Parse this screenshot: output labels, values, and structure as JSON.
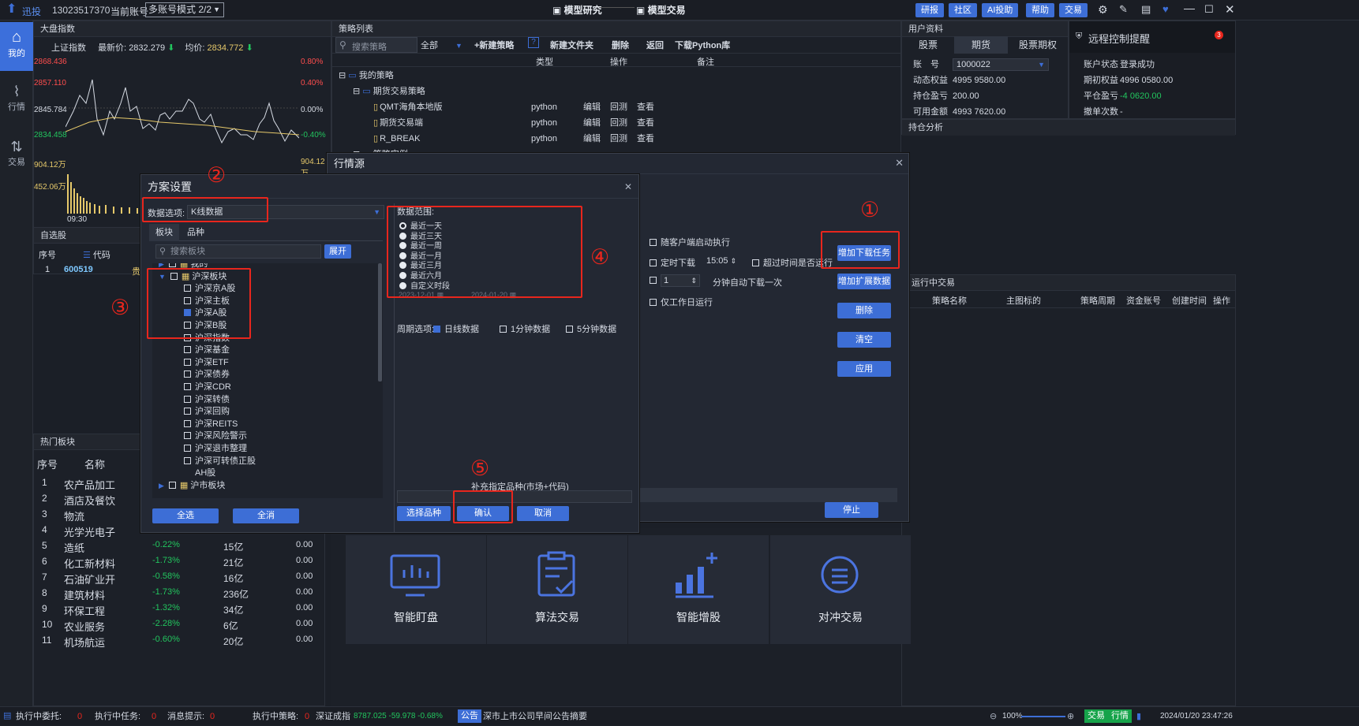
{
  "topbar": {
    "logo_label": "迅投",
    "phone": "13023517370",
    "account_label": "当前账号",
    "account_mode": "多账号模式 2/2",
    "center_tab1": "模型研究",
    "center_tab2": "模型交易",
    "buttons": [
      "研报",
      "社区",
      "AI投助",
      "帮助",
      "交易"
    ]
  },
  "leftnav": {
    "items": [
      "我的",
      "行情",
      "交易"
    ]
  },
  "market_index": {
    "panel_title": "大盘指数",
    "index_name": "上证指数",
    "latest_label": "最新价:",
    "latest_value": "2832.279",
    "avg_label": "均价:",
    "avg_value": "2834.772",
    "y_left": [
      "2868.436",
      "2857.110",
      "2845.784",
      "2834.458",
      "904.12万",
      "452.06万"
    ],
    "y_right": [
      "0.80%",
      "0.40%",
      "0.00%",
      "-0.40%",
      "904.12万"
    ],
    "time_label": "09:30"
  },
  "watchlist": {
    "title": "自选股",
    "col_no": "序号",
    "col_code": "代码",
    "row_no": "1",
    "row_code": "600519",
    "row_extra": "贵"
  },
  "hot_sectors": {
    "title": "热门板块",
    "col_no": "序号",
    "col_name": "名称",
    "rows": [
      {
        "no": "1",
        "name": "农产品加工",
        "pct": "",
        "amt": "",
        "val": ""
      },
      {
        "no": "2",
        "name": "酒店及餐饮",
        "pct": "",
        "amt": "",
        "val": ""
      },
      {
        "no": "3",
        "name": "物流",
        "pct": "",
        "amt": "",
        "val": ""
      },
      {
        "no": "4",
        "name": "光学光电子",
        "pct": "",
        "amt": "",
        "val": ""
      },
      {
        "no": "5",
        "name": "造纸",
        "pct": "-0.22%",
        "amt": "15亿",
        "val": "0.00"
      },
      {
        "no": "6",
        "name": "化工新材料",
        "pct": "-1.73%",
        "amt": "21亿",
        "val": "0.00"
      },
      {
        "no": "7",
        "name": "石油矿业开",
        "pct": "-0.58%",
        "amt": "16亿",
        "val": "0.00"
      },
      {
        "no": "8",
        "name": "建筑材料",
        "pct": "-1.73%",
        "amt": "236亿",
        "val": "0.00"
      },
      {
        "no": "9",
        "name": "环保工程",
        "pct": "-1.32%",
        "amt": "34亿",
        "val": "0.00"
      },
      {
        "no": "10",
        "name": "农业服务",
        "pct": "-2.28%",
        "amt": "6亿",
        "val": "0.00"
      },
      {
        "no": "11",
        "name": "机场航运",
        "pct": "-0.60%",
        "amt": "20亿",
        "val": "0.00"
      }
    ]
  },
  "strategy_list": {
    "title": "策略列表",
    "search_placeholder": "搜索策略",
    "filter_all": "全部",
    "new_strategy": "+新建策略",
    "help": "?",
    "new_folder": "新建文件夹",
    "delete": "删除",
    "back": "返回",
    "download_py": "下载Python库",
    "col_type": "类型",
    "col_ops": "操作",
    "col_note": "备注",
    "folder1": "我的策略",
    "folder2": "期货交易策略",
    "items": [
      {
        "name": "QMT海角本地版",
        "type": "python",
        "edit": "编辑",
        "back": "回测",
        "view": "查看"
      },
      {
        "name": "期货交易端",
        "type": "python",
        "edit": "编辑",
        "back": "回测",
        "view": "查看"
      },
      {
        "name": "R_BREAK",
        "type": "python",
        "edit": "编辑",
        "back": "回测",
        "view": "查看"
      }
    ],
    "folder3": "策略实例"
  },
  "user_info": {
    "title": "用户资料",
    "tabs": [
      "股票",
      "期货",
      "股票期权"
    ],
    "acct_label": "账　号",
    "acct_value": "1000022",
    "dyn_label": "动态权益",
    "dyn_value": "4995 9580.00",
    "pos_label": "持仓盈亏",
    "pos_value": "200.00",
    "avail_label": "可用金额",
    "avail_value": "4993 7620.00",
    "status_label": "账户状态",
    "status_value": "登录成功",
    "init_label": "期初权益",
    "init_value": "4996 0580.00",
    "close_label": "平仓盈亏",
    "close_value": "-4 0620.00",
    "cancel_label": "撤单次数",
    "cancel_value": "-",
    "remote_title": "远程控制提醒",
    "remote_badge": "3",
    "analysis_title": "持仓分析"
  },
  "running": {
    "title": "运行中交易",
    "cols": [
      "策略名称",
      "主图标的",
      "策略周期",
      "资金账号",
      "创建时间",
      "操作"
    ]
  },
  "market_source": {
    "title": "行情源",
    "cb_run_on_start": "随客户端启动执行",
    "cb_timed_dl": "定时下载",
    "time_value": "15:05",
    "cb_overtime": "超过时间是否运行",
    "interval_value": "1",
    "interval_label": "分钟自动下载一次",
    "cb_workday": "仅工作日运行",
    "btn_add_dl": "增加下载任务",
    "btn_add_ext": "增加扩展数据",
    "btn_delete": "删除",
    "btn_clear": "清空",
    "btn_apply": "应用",
    "btn_stop": "停止"
  },
  "plan": {
    "title": "方案设置",
    "data_option_label": "数据选项:",
    "data_option_value": "K线数据",
    "tabs": [
      "板块",
      "品种"
    ],
    "search_placeholder": "搜索板块",
    "expand_btn": "展开",
    "tree": [
      {
        "label": "我的",
        "level": 0,
        "checked": false
      },
      {
        "label": "沪深板块",
        "level": 0,
        "checked": false
      },
      {
        "label": "沪深京A股",
        "level": 1,
        "checked": false
      },
      {
        "label": "沪深主板",
        "level": 1,
        "checked": false
      },
      {
        "label": "沪深A股",
        "level": 1,
        "checked": true
      },
      {
        "label": "沪深B股",
        "level": 1,
        "checked": false
      },
      {
        "label": "沪深指数",
        "level": 1,
        "checked": false
      },
      {
        "label": "沪深基金",
        "level": 1,
        "checked": false
      },
      {
        "label": "沪深ETF",
        "level": 1,
        "checked": false
      },
      {
        "label": "沪深债券",
        "level": 1,
        "checked": false
      },
      {
        "label": "沪深CDR",
        "level": 1,
        "checked": false
      },
      {
        "label": "沪深转债",
        "level": 1,
        "checked": false
      },
      {
        "label": "沪深回购",
        "level": 1,
        "checked": false
      },
      {
        "label": "沪深REITS",
        "level": 1,
        "checked": false
      },
      {
        "label": "沪深风险警示",
        "level": 1,
        "checked": false
      },
      {
        "label": "沪深退市整理",
        "level": 1,
        "checked": false
      },
      {
        "label": "沪深可转债正股",
        "level": 1,
        "checked": false
      },
      {
        "label": "AH股",
        "level": 1,
        "checked": false
      },
      {
        "label": "沪市板块",
        "level": 0,
        "checked": false
      }
    ],
    "btn_select_all": "全选",
    "btn_clear_all": "全消",
    "range_title": "数据范围:",
    "ranges": [
      "最近一天",
      "最近三天",
      "最近一周",
      "最近一月",
      "最近三月",
      "最近六月",
      "自定义时段"
    ],
    "selected_range": "最近一天",
    "date_from": "2023-12-01",
    "date_to": "2024-01-20",
    "period_label": "周期选项:",
    "period_daily": "日线数据",
    "period_1m": "1分钟数据",
    "period_5m": "5分钟数据",
    "supplement_label": "补充指定品种(市场+代码)",
    "btn_select_variety": "选择品种",
    "btn_confirm": "确认",
    "btn_cancel": "取消"
  },
  "annotations": [
    "①",
    "②",
    "③",
    "④",
    "⑤"
  ],
  "tiles": [
    "智能盯盘",
    "算法交易",
    "智能增股",
    "对冲交易"
  ],
  "statusbar": {
    "exec_entrust_label": "执行中委托:",
    "exec_entrust_value": "0",
    "exec_task_label": "执行中任务:",
    "exec_task_value": "0",
    "msg_label": "消息提示:",
    "msg_value": "0",
    "exec_strategy_label": "执行中策略:",
    "exec_strategy_value": "0",
    "index_label": "深证成指",
    "index_values": "8787.025  -59.978  -0.68%",
    "notice_tag": "公告",
    "notice_text": "深市上市公司早间公告摘要",
    "zoom": "100%",
    "trade_tag": "交易",
    "quote_tag": "行情",
    "datetime": "2024/01/20 23:47:26"
  },
  "colors": {
    "accent": "#3d6ed6",
    "annotation_red": "#e8261d",
    "down_green": "#22c55e",
    "price_up_red": "#ff4d4d"
  }
}
